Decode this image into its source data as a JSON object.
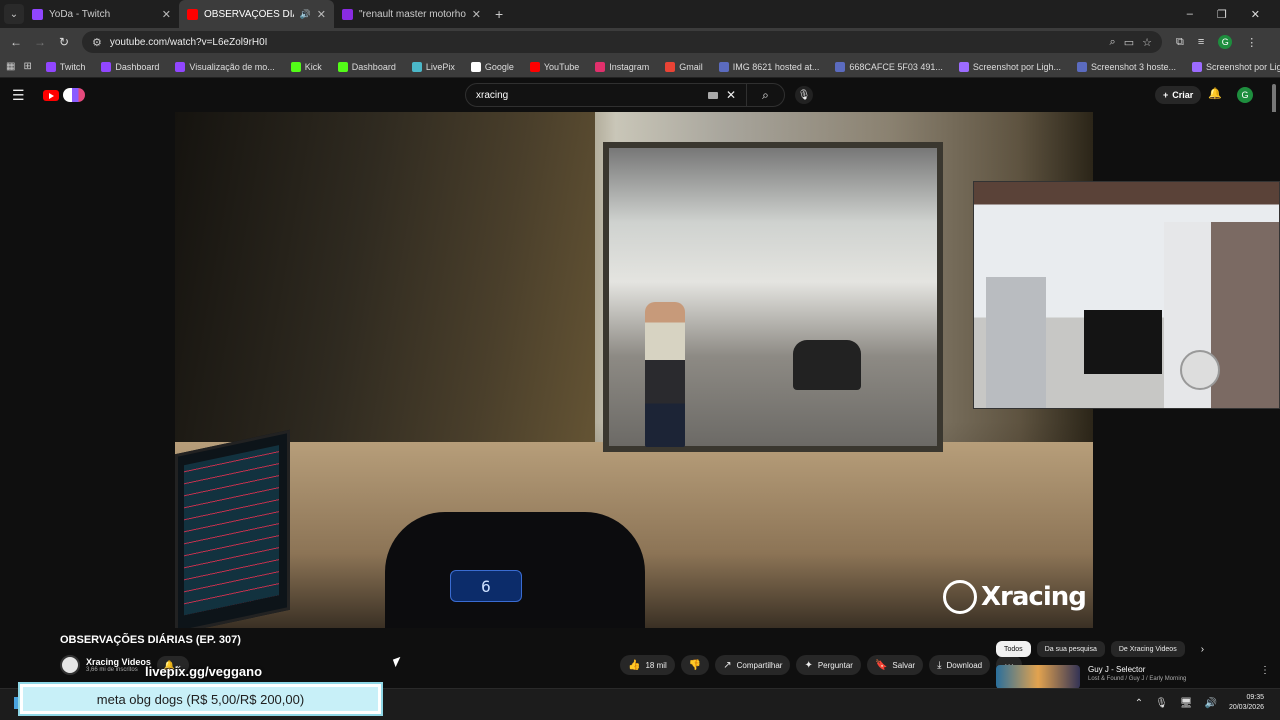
{
  "browser": {
    "tabs": [
      {
        "title": "YoDa - Twitch",
        "color": "#9146ff"
      },
      {
        "title": "OBSERVAÇÕES DIÁRIAS (EP.",
        "color": "#ff0000",
        "active": true,
        "audio": "🔊"
      },
      {
        "title": "\"renault master motorhome\" -",
        "color": "#8a2be2"
      }
    ],
    "new_tab": "+",
    "window_controls": [
      "–",
      "❐",
      "✕"
    ],
    "url": "youtube.com/watch?v=L6eZol9rH0I",
    "bookmarks": [
      {
        "label": "Twitch",
        "color": "#9146ff"
      },
      {
        "label": "Dashboard",
        "color": "#9146ff"
      },
      {
        "label": "Visualização de mo...",
        "color": "#9146ff"
      },
      {
        "label": "Kick",
        "color": "#53fc18"
      },
      {
        "label": "Dashboard",
        "color": "#53fc18"
      },
      {
        "label": "LivePix",
        "color": "#4bb8c9"
      },
      {
        "label": "Google",
        "color": "#ffffff"
      },
      {
        "label": "YouTube",
        "color": "#ff0000"
      },
      {
        "label": "Instagram",
        "color": "#e1306c"
      },
      {
        "label": "Gmail",
        "color": "#ea4335"
      },
      {
        "label": "IMG 8621 hosted at...",
        "color": "#5b6bbf"
      },
      {
        "label": "668CAFCE 5F03 491...",
        "color": "#5b6bbf"
      },
      {
        "label": "Screenshot por Ligh...",
        "color": "#9c6bff"
      },
      {
        "label": "Screenshot 3 hoste...",
        "color": "#5b6bbf"
      },
      {
        "label": "Screenshot por Ligh...",
        "color": "#9c6bff"
      }
    ]
  },
  "youtube": {
    "search_value": "xracing",
    "create_label": "Criar",
    "avatar_letter": "G",
    "video": {
      "speed_display": "6",
      "watermark": "Xracing"
    },
    "title": "OBSERVAÇÕES DIÁRIAS (EP. 307)",
    "channel_name": "Xracing Videos",
    "channel_subs": "3,66 mi de inscritos",
    "overlay_text": "livepix.gg/veggano",
    "actions": [
      {
        "label": "18 mil",
        "icon": "👍"
      },
      {
        "label": "",
        "icon": "👎"
      },
      {
        "label": "Compartilhar",
        "icon": "↗"
      },
      {
        "label": "Perguntar",
        "icon": "✦"
      },
      {
        "label": "Salvar",
        "icon": "🔖"
      },
      {
        "label": "Download",
        "icon": "⤓"
      },
      {
        "label": "",
        "icon": "⋯"
      }
    ],
    "chips": [
      "Todos",
      "Da sua pesquisa",
      "De Xracing Videos"
    ],
    "recommendation": {
      "title": "Guy J - Selector",
      "subtitle": "Lost & Found / Guy J / Early Morning"
    }
  },
  "stream_overlay": {
    "meta_banner": "meta obg dogs (R$ 5,00/R$ 200,00)"
  },
  "taskbar": {
    "time": "09:35",
    "date": "20/03/2026"
  }
}
